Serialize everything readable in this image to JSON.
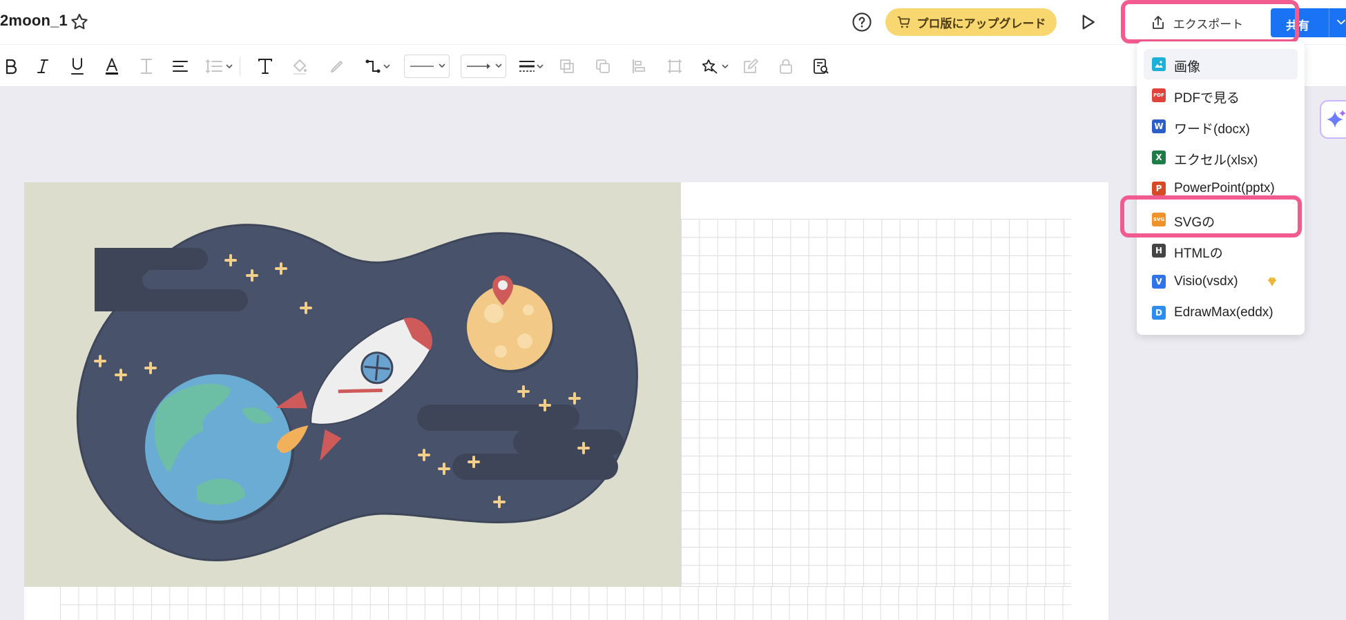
{
  "header": {
    "doc_title": "2moon_1",
    "upgrade_label": "プロ版にアップグレード",
    "export_label": "エクスポート",
    "share_label": "共有"
  },
  "toolbar": {
    "icons": [
      "bold-icon",
      "italic-icon",
      "underline-icon",
      "font-color-icon",
      "text-style-icon",
      "align-icon",
      "line-spacing-icon",
      "text-icon",
      "fill-icon",
      "pen-icon",
      "connector-icon",
      "line-style-select",
      "arrow-style-select",
      "line-weight-icon",
      "group-icon",
      "ungroup-icon",
      "align-objects-icon",
      "crop-icon",
      "magic-icon",
      "edit-icon",
      "lock-icon",
      "find-icon"
    ]
  },
  "export_menu": {
    "items": [
      {
        "label": "画像",
        "icon": "image-icon",
        "icon_text": "",
        "color": "#1fb0d9"
      },
      {
        "label": "PDFで見る",
        "icon": "pdf-icon",
        "icon_text": "PDF",
        "color": "#e0433a"
      },
      {
        "label": "ワード(docx)",
        "icon": "word-icon",
        "icon_text": "W",
        "color": "#2b5fc7"
      },
      {
        "label": "エクセル(xlsx)",
        "icon": "excel-icon",
        "icon_text": "X",
        "color": "#1e7d46"
      },
      {
        "label": "PowerPoint(pptx)",
        "icon": "powerpoint-icon",
        "icon_text": "P",
        "color": "#d64a25"
      },
      {
        "label": "SVGの",
        "icon": "svg-icon",
        "icon_text": "SVG",
        "color": "#f0922a"
      },
      {
        "label": "HTMLの",
        "icon": "html-icon",
        "icon_text": "H",
        "color": "#454545"
      },
      {
        "label": "Visio(vsdx)",
        "icon": "visio-icon",
        "icon_text": "V",
        "color": "#2f74e8"
      },
      {
        "label": "EdrawMax(eddx)",
        "icon": "edrawmax-icon",
        "icon_text": "D",
        "color": "#2d8cf0"
      }
    ]
  },
  "colors": {
    "accent": "#1a73f5",
    "highlight": "#f25b8f",
    "upgrade": "#f9d770"
  }
}
